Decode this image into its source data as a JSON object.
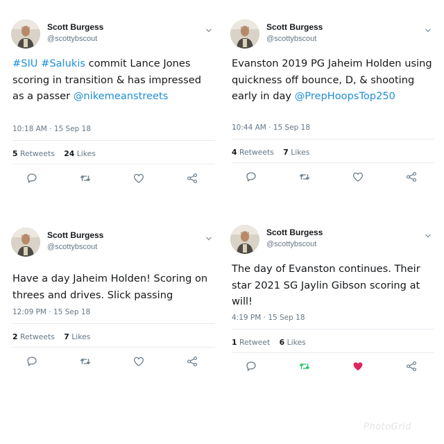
{
  "tweets": [
    {
      "author": "Scott Burgess",
      "handle": "@scottybscout",
      "text_segments": [
        {
          "text": "#SIU",
          "link": true
        },
        {
          "text": " ",
          "link": false
        },
        {
          "text": "#Salukis",
          "link": true
        },
        {
          "text": " commit Lance Jones scoring in transition & has impressed as a passer ",
          "link": false
        },
        {
          "text": "@nikemeanstreets",
          "link": true
        }
      ],
      "time": "10:18 AM · 15 Sep 18",
      "retweets": "5",
      "retweets_label": "Retweets",
      "likes": "24",
      "likes_label": "Likes",
      "retweeted": false,
      "liked": false
    },
    {
      "author": "Scott Burgess",
      "handle": "@scottybscout",
      "text_segments": [
        {
          "text": "Evanston 2019 PG Jaheim Holden using quickness off bounce, D, & shooting early in day ",
          "link": false
        },
        {
          "text": "@PrepHoopsTop250",
          "link": true
        }
      ],
      "time": "10:44 AM · 15 Sep 18",
      "retweets": "4",
      "retweets_label": "Retweets",
      "likes": "7",
      "likes_label": "Likes",
      "retweeted": false,
      "liked": false
    },
    {
      "author": "Scott Burgess",
      "handle": "@scottybscout",
      "text_segments": [
        {
          "text": "Have a day Jaheim Holden! Scoring on threes and drives. Slick passing",
          "link": false
        }
      ],
      "time": "12:09 PM · 15 Sep 18",
      "retweets": "2",
      "retweets_label": "Retweets",
      "likes": "7",
      "likes_label": "Likes",
      "retweeted": false,
      "liked": false
    },
    {
      "author": "Scott Burgess",
      "handle": "@scottybscout",
      "text_segments": [
        {
          "text": "The day of Evanston continues. Their star 2021 SG Jaylin Gibson scoring at will!",
          "link": false
        }
      ],
      "time": "4:19 PM · 15 Sep 18",
      "retweets": "1",
      "retweets_label": "Retweet",
      "likes": "6",
      "likes_label": "Likes",
      "retweeted": true,
      "liked": true
    }
  ],
  "watermark": "PhotoGrid",
  "colors": {
    "link": "#1d8ed6",
    "muted": "#657786",
    "icon": "#687a87",
    "retweet_active": "#17bf63",
    "like_active": "#e0245e",
    "divider": "#e6ecf0"
  },
  "icons": [
    "chevron-down-icon",
    "reply-icon",
    "retweet-icon",
    "like-icon",
    "share-icon"
  ]
}
